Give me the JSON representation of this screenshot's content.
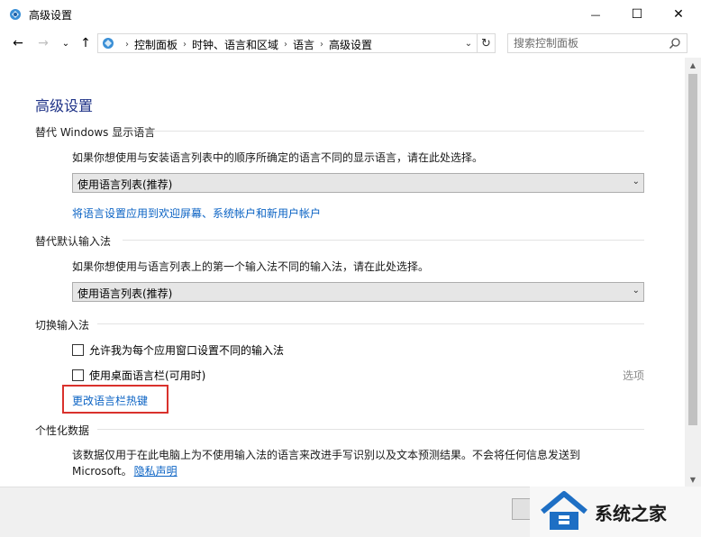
{
  "window": {
    "title": "高级设置",
    "minimize_glyph": "—",
    "maximize_glyph": "☐",
    "close_glyph": "✕"
  },
  "nav": {
    "back_glyph": "←",
    "forward_glyph": "→",
    "recent_glyph": "⌄",
    "up_glyph": "↑",
    "refresh_glyph": "↻",
    "dropdown_glyph": "⌄"
  },
  "breadcrumb": {
    "items": [
      "控制面板",
      "时钟、语言和区域",
      "语言",
      "高级设置"
    ],
    "separator": "›"
  },
  "search": {
    "placeholder": "搜索控制面板"
  },
  "page": {
    "title": "高级设置",
    "display_lang": {
      "heading": "替代 Windows 显示语言",
      "description": "如果你想使用与安装语言列表中的顺序所确定的语言不同的显示语言，请在此处选择。",
      "select_value": "使用语言列表(推荐)",
      "apply_link": "将语言设置应用到欢迎屏幕、系统帐户和新用户帐户"
    },
    "input_method": {
      "heading": "替代默认输入法",
      "description": "如果你想使用与语言列表上的第一个输入法不同的输入法，请在此处选择。",
      "select_value": "使用语言列表(推荐)"
    },
    "switch_input": {
      "heading": "切换输入法",
      "checkbox1_label": "允许我为每个应用窗口设置不同的输入法",
      "checkbox1_checked": false,
      "checkbox2_label": "使用桌面语言栏(可用时)",
      "checkbox2_checked": false,
      "options_link": "选项",
      "hotkeys_link": "更改语言栏热键"
    },
    "personalization": {
      "heading": "个性化数据",
      "description_line1": "该数据仅用于在此电脑上为不使用输入法的语言来改进手写识别以及文本预测结果。不会将任何信息发送到",
      "description_line2_prefix": "Microsoft。",
      "privacy_link": "隐私声明"
    }
  },
  "watermark": {
    "text": "系统之家"
  },
  "colors": {
    "title_blue": "#1e3287",
    "link_blue": "#0b63c4",
    "highlight_red": "#d9312c"
  }
}
